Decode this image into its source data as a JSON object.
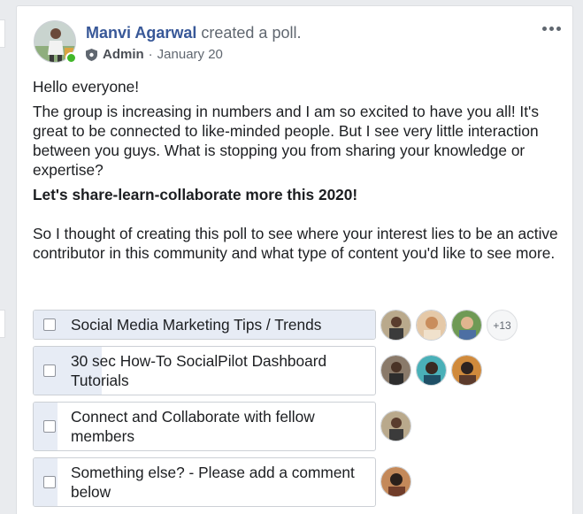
{
  "post": {
    "author_name": "Manvi Agarwal",
    "action_text": "created a poll.",
    "role_label": "Admin",
    "separator": "·",
    "date": "January 20",
    "more_icon": "more-horizontal-icon",
    "online_color": "#42b72a"
  },
  "body": {
    "greeting": "Hello everyone!",
    "paragraph_1": "The group is increasing in numbers and I am so excited to have you all! It's great to be connected to like-minded people. But I see very little interaction between you guys. What is stopping you from sharing your knowledge or expertise?",
    "emphasis": "Let's share-learn-collaborate more this 2020!",
    "paragraph_2": "So I thought of creating this poll to see where your interest lies to be an active contributor in this community and what type of content you'd like to see more."
  },
  "poll": {
    "options": [
      {
        "label": "Social Media Marketing Tips / Trends",
        "vote_share": 1.0,
        "voter_avatars": 3,
        "more_voters": "+13"
      },
      {
        "label": "30 sec How-To SocialPilot Dashboard Tutorials",
        "vote_share": 0.2,
        "voter_avatars": 3,
        "more_voters": null
      },
      {
        "label": "Connect and Collaborate with fellow members",
        "vote_share": 0.07,
        "voter_avatars": 1,
        "more_voters": null
      },
      {
        "label": "Something else? - Please add a comment below",
        "vote_share": 0.07,
        "voter_avatars": 1,
        "more_voters": null
      }
    ]
  },
  "colors": {
    "author": "#385898",
    "secondary_text": "#606770",
    "poll_fill": "#e7ecf5",
    "border": "#dddfe2"
  }
}
